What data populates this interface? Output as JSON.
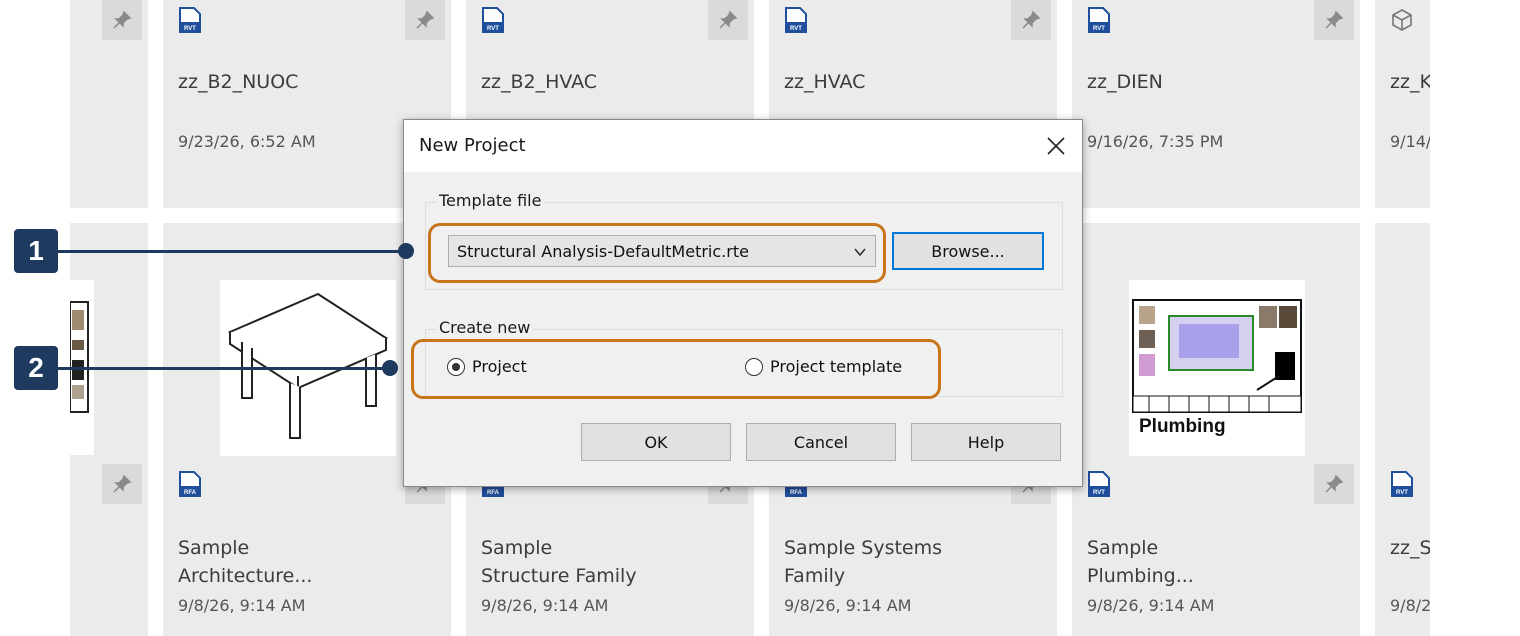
{
  "tiles_top": [
    {
      "title": "zz_B2_NUOC",
      "date": "9/23/26, 6:52 AM",
      "icon": "rvt-file-icon"
    },
    {
      "title": "zz_B2_HVAC",
      "date": "",
      "icon": "rvt-file-icon"
    },
    {
      "title": "zz_HVAC",
      "date": "",
      "icon": "rvt-file-icon"
    },
    {
      "title": "zz_DIEN",
      "date": "9/16/26, 7:35 PM",
      "icon": "rvt-file-icon"
    },
    {
      "title": "zz_K",
      "date": "9/14/",
      "icon": "cube-icon"
    }
  ],
  "tiles_bottom": [
    {
      "title": "Sample\nArchitecture...",
      "date": "9/8/26, 9:14 AM",
      "icon": "rfa-file-icon"
    },
    {
      "title": "Sample\nStructure Family",
      "date": "9/8/26, 9:14 AM",
      "icon": "rfa-file-icon"
    },
    {
      "title": "Sample Systems\nFamily",
      "date": "9/8/26, 9:14 AM",
      "icon": "rfa-file-icon"
    },
    {
      "title": "Sample\nPlumbing...",
      "date": "9/8/26, 9:14 AM",
      "icon": "rvt-file-icon"
    },
    {
      "title": "zz_S",
      "date": "9/8/2",
      "icon": "rvt-file-icon"
    }
  ],
  "thumb_plumbing_label": "Plumbing",
  "file_icon_labels": {
    "rvt": "RVT",
    "rfa": "RFA"
  },
  "dialog": {
    "title": "New Project",
    "template_group_label": "Template file",
    "template_value": "Structural Analysis-DefaultMetric.rte",
    "browse_label": "Browse...",
    "create_group_label": "Create new",
    "radio_project_label": "Project",
    "radio_template_label": "Project template",
    "selected": "Project",
    "ok_label": "OK",
    "cancel_label": "Cancel",
    "help_label": "Help"
  },
  "callouts": [
    "1",
    "2"
  ],
  "colors": {
    "accent_highlight": "#c8741a",
    "callout": "#1e3a5f",
    "file_icon": "#1f4e9c",
    "focus": "#0078d7"
  }
}
